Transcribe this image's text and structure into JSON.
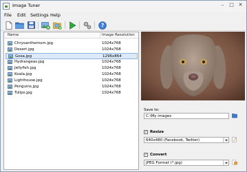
{
  "window": {
    "title": "Image Tuner"
  },
  "menu": [
    "File",
    "Edit",
    "Settings",
    "Help"
  ],
  "toolbar": {
    "icons": [
      "new-icon",
      "open-folder-icon",
      "save-icon",
      "add-images-icon",
      "add-folder-icon",
      "run-icon",
      "settings-icon",
      "help-icon"
    ]
  },
  "list": {
    "col_name": "Name",
    "col_resolution": "Image Resolution",
    "rows": [
      {
        "name": "Chrysanthemum.jpg",
        "res": "1024x768"
      },
      {
        "name": "Desert.jpg",
        "res": "1024x768"
      },
      {
        "name": "Gosa.jpg",
        "res": "1296x864"
      },
      {
        "name": "Hydrangeas.jpg",
        "res": "1024x768"
      },
      {
        "name": "Jellyfish.jpg",
        "res": "1024x768"
      },
      {
        "name": "Koala.jpg",
        "res": "1024x768"
      },
      {
        "name": "Lighthouse.jpg",
        "res": "1024x768"
      },
      {
        "name": "Penguins.jpg",
        "res": "1024x768"
      },
      {
        "name": "Tulips.jpg",
        "res": "1024x768"
      }
    ],
    "selected_index": 2
  },
  "options": {
    "save_to_label": "Save to:",
    "save_to_value": "C:\\My images",
    "resize_label": "Resize",
    "resize_checked": true,
    "resize_value": "640x480 (Facebook, Twitter)",
    "convert_label": "Convert",
    "convert_checked": true,
    "convert_value": "JPEG Format (*.jpg)"
  },
  "colors": {
    "accent": "#dce9f9",
    "selection_border": "#8fb2e0"
  }
}
